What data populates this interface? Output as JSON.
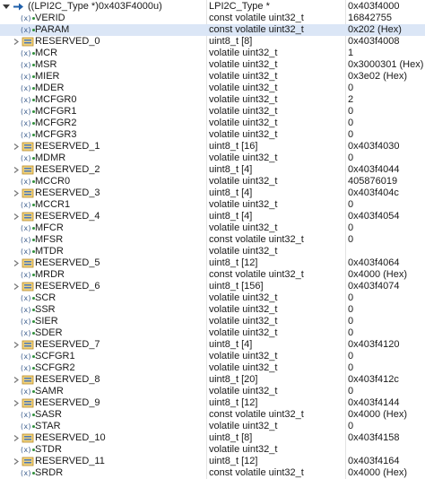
{
  "root": {
    "name": "((LPI2C_Type *)0x403F4000u)",
    "type": "LPI2C_Type *",
    "value": "0x403f4000"
  },
  "rows": [
    {
      "name": "VERID",
      "kind": "var",
      "type": "const volatile uint32_t",
      "value": "16842755"
    },
    {
      "name": "PARAM",
      "kind": "var",
      "type": "const volatile uint32_t",
      "value": "0x202 (Hex)",
      "selected": true
    },
    {
      "name": "RESERVED_0",
      "kind": "array",
      "type": "uint8_t [8]",
      "value": "0x403f4008"
    },
    {
      "name": "MCR",
      "kind": "var",
      "type": "volatile uint32_t",
      "value": "1"
    },
    {
      "name": "MSR",
      "kind": "var",
      "type": "volatile uint32_t",
      "value": "0x3000301 (Hex)"
    },
    {
      "name": "MIER",
      "kind": "var",
      "type": "volatile uint32_t",
      "value": "0x3e02 (Hex)"
    },
    {
      "name": "MDER",
      "kind": "var",
      "type": "volatile uint32_t",
      "value": "0"
    },
    {
      "name": "MCFGR0",
      "kind": "var",
      "type": "volatile uint32_t",
      "value": "2"
    },
    {
      "name": "MCFGR1",
      "kind": "var",
      "type": "volatile uint32_t",
      "value": "0"
    },
    {
      "name": "MCFGR2",
      "kind": "var",
      "type": "volatile uint32_t",
      "value": "0"
    },
    {
      "name": "MCFGR3",
      "kind": "var",
      "type": "volatile uint32_t",
      "value": "0"
    },
    {
      "name": "RESERVED_1",
      "kind": "array",
      "type": "uint8_t [16]",
      "value": "0x403f4030"
    },
    {
      "name": "MDMR",
      "kind": "var",
      "type": "volatile uint32_t",
      "value": "0"
    },
    {
      "name": "RESERVED_2",
      "kind": "array",
      "type": "uint8_t [4]",
      "value": "0x403f4044"
    },
    {
      "name": "MCCR0",
      "kind": "var",
      "type": "volatile uint32_t",
      "value": "405876019"
    },
    {
      "name": "RESERVED_3",
      "kind": "array",
      "type": "uint8_t [4]",
      "value": "0x403f404c"
    },
    {
      "name": "MCCR1",
      "kind": "var",
      "type": "volatile uint32_t",
      "value": "0"
    },
    {
      "name": "RESERVED_4",
      "kind": "array",
      "type": "uint8_t [4]",
      "value": "0x403f4054"
    },
    {
      "name": "MFCR",
      "kind": "var",
      "type": "volatile uint32_t",
      "value": "0"
    },
    {
      "name": "MFSR",
      "kind": "var",
      "type": "const volatile uint32_t",
      "value": "0"
    },
    {
      "name": "MTDR",
      "kind": "var",
      "type": "volatile uint32_t",
      "value": ""
    },
    {
      "name": "RESERVED_5",
      "kind": "array",
      "type": "uint8_t [12]",
      "value": "0x403f4064"
    },
    {
      "name": "MRDR",
      "kind": "var",
      "type": "const volatile uint32_t",
      "value": "0x4000 (Hex)"
    },
    {
      "name": "RESERVED_6",
      "kind": "array",
      "type": "uint8_t [156]",
      "value": "0x403f4074"
    },
    {
      "name": "SCR",
      "kind": "var",
      "type": "volatile uint32_t",
      "value": "0"
    },
    {
      "name": "SSR",
      "kind": "var",
      "type": "volatile uint32_t",
      "value": "0"
    },
    {
      "name": "SIER",
      "kind": "var",
      "type": "volatile uint32_t",
      "value": "0"
    },
    {
      "name": "SDER",
      "kind": "var",
      "type": "volatile uint32_t",
      "value": "0"
    },
    {
      "name": "RESERVED_7",
      "kind": "array",
      "type": "uint8_t [4]",
      "value": "0x403f4120"
    },
    {
      "name": "SCFGR1",
      "kind": "var",
      "type": "volatile uint32_t",
      "value": "0"
    },
    {
      "name": "SCFGR2",
      "kind": "var",
      "type": "volatile uint32_t",
      "value": "0"
    },
    {
      "name": "RESERVED_8",
      "kind": "array",
      "type": "uint8_t [20]",
      "value": "0x403f412c"
    },
    {
      "name": "SAMR",
      "kind": "var",
      "type": "volatile uint32_t",
      "value": "0"
    },
    {
      "name": "RESERVED_9",
      "kind": "array",
      "type": "uint8_t [12]",
      "value": "0x403f4144"
    },
    {
      "name": "SASR",
      "kind": "var",
      "type": "const volatile uint32_t",
      "value": "0x4000 (Hex)"
    },
    {
      "name": "STAR",
      "kind": "var",
      "type": "volatile uint32_t",
      "value": "0"
    },
    {
      "name": "RESERVED_10",
      "kind": "array",
      "type": "uint8_t [8]",
      "value": "0x403f4158"
    },
    {
      "name": "STDR",
      "kind": "var",
      "type": "volatile uint32_t",
      "value": ""
    },
    {
      "name": "RESERVED_11",
      "kind": "array",
      "type": "uint8_t [12]",
      "value": "0x403f4164"
    },
    {
      "name": "SRDR",
      "kind": "var",
      "type": "const volatile uint32_t",
      "value": "0x4000 (Hex)"
    }
  ],
  "colors": {
    "selected_bg": "#dbe6f6",
    "variable_icon_dot": "#2f8f3a",
    "array_icon": "#d9a441"
  },
  "icons": {
    "variable": "variable-icon",
    "array": "array-icon",
    "expand": "chevron-right-icon",
    "root": "pointer-icon"
  }
}
